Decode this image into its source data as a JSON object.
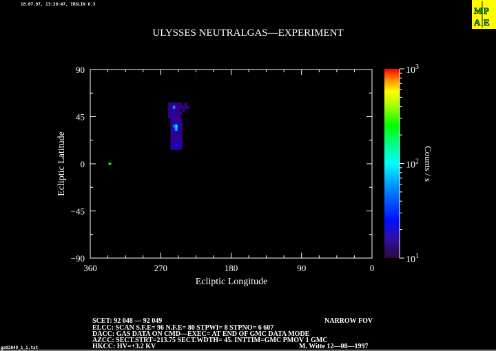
{
  "header": {
    "timestamp_line": "18.07.97, 13:28:47, IDSLIN 6.3",
    "logo_text": "MPAE",
    "logo_colors": {
      "background": "#ffff00",
      "letters": "#00cc00",
      "outline": "#000000"
    }
  },
  "footer": {
    "filename": "ga92049_1_1.txt",
    "info_lines": [
      "SCET: 92 048 — 92 049",
      "ELCC: SCAN   S.F.E= 96 N.F.E= 80 STPWI=   8  STPNO=   6     607",
      "DACC: GAS DATA ON   CMD—EXEC= AT END OF GMC      DATA MODE",
      "AZCC: SECT.STRT=213.75 SECT.WDTH= 45. INTTIM=GMC PMOV 1 GMC",
      "HKCC: HV=+3.2 KV"
    ],
    "fov": "NARROW FOV",
    "author": "M. Witte 12—08—1997"
  },
  "chart_data": {
    "type": "heatmap",
    "title": "ULYSSES NEUTRALGAS—EXPERIMENT",
    "xlabel": "Ecliptic Longitude",
    "ylabel": "Ecliptic Latitude",
    "xlim": [
      360,
      0
    ],
    "ylim": [
      -90,
      90
    ],
    "x_ticks": [
      "360",
      "270",
      "180",
      "90",
      "0"
    ],
    "x_tick_values": [
      360,
      270,
      180,
      90,
      0
    ],
    "y_ticks": [
      "90",
      "45",
      "0",
      "−45",
      "−90"
    ],
    "y_tick_values": [
      90,
      45,
      0,
      -45,
      -90
    ],
    "grid": false,
    "colorbar": {
      "label": "Counts / s",
      "scale": "log",
      "range": [
        10,
        1000
      ],
      "ticks": [
        {
          "base": "10",
          "exp": "3",
          "value": 1000
        },
        {
          "base": "10",
          "exp": "2",
          "value": 100
        },
        {
          "base": "10",
          "exp": "1",
          "value": 10
        }
      ],
      "colormap": "rainbow (purple-blue-cyan-green-yellow-red)"
    },
    "grid_cells": {
      "lon_values": [
        262,
        259,
        256,
        253,
        250,
        247,
        244,
        241,
        238,
        235,
        232
      ],
      "lat_values": [
        57,
        54,
        51,
        48,
        45,
        42,
        39,
        36,
        33,
        30,
        27,
        24,
        21,
        18,
        15
      ],
      "bin_size_deg": 3,
      "counts": [
        [
          0,
          14,
          13,
          14,
          12,
          13,
          12,
          0,
          12,
          0,
          0
        ],
        [
          0,
          13,
          14,
          35,
          16,
          13,
          14,
          12,
          13,
          12,
          0
        ],
        [
          0,
          14,
          13,
          15,
          14,
          12,
          0,
          12,
          0,
          0,
          0
        ],
        [
          0,
          13,
          15,
          14,
          13,
          14,
          12,
          0,
          0,
          0,
          0
        ],
        [
          0,
          14,
          13,
          16,
          14,
          13,
          0,
          0,
          0,
          0,
          0
        ],
        [
          0,
          0,
          14,
          15,
          13,
          14,
          12,
          0,
          0,
          0,
          0
        ],
        [
          0,
          0,
          15,
          16,
          18,
          14,
          13,
          0,
          0,
          0,
          0
        ],
        [
          0,
          0,
          14,
          30,
          80,
          20,
          13,
          0,
          0,
          0,
          0
        ],
        [
          0,
          0,
          13,
          22,
          40,
          16,
          14,
          0,
          0,
          0,
          0
        ],
        [
          0,
          0,
          14,
          15,
          14,
          13,
          12,
          0,
          0,
          0,
          0
        ],
        [
          0,
          0,
          13,
          14,
          13,
          14,
          13,
          0,
          0,
          0,
          0
        ],
        [
          0,
          0,
          14,
          13,
          15,
          13,
          14,
          0,
          0,
          0,
          0
        ],
        [
          0,
          0,
          15,
          14,
          16,
          14,
          15,
          0,
          0,
          0,
          0
        ],
        [
          0,
          0,
          16,
          17,
          18,
          16,
          15,
          0,
          0,
          0,
          0
        ],
        [
          0,
          0,
          14,
          15,
          16,
          15,
          14,
          0,
          0,
          0,
          0
        ]
      ]
    },
    "isolated_points": [
      {
        "lon": 335,
        "lat": 0,
        "counts": 150
      }
    ]
  }
}
